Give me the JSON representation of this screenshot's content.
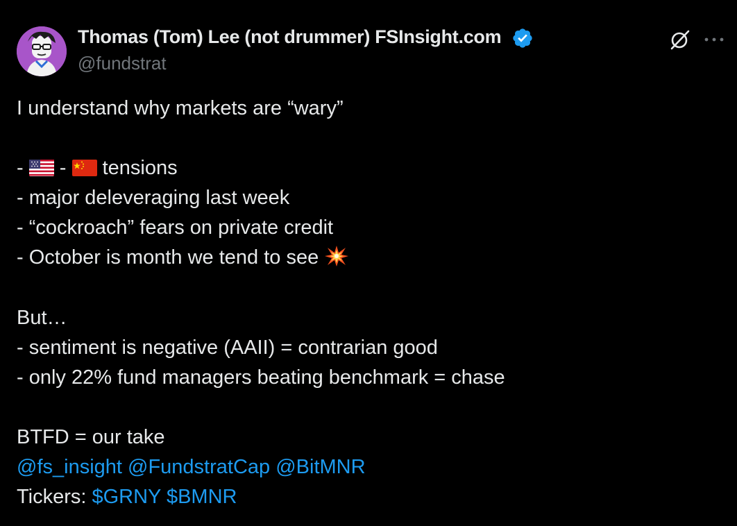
{
  "author": {
    "display_name": "Thomas (Tom) Lee (not drummer) FSInsight.com",
    "handle": "@fundstrat",
    "verified": true,
    "avatar_bg": "#a855c9"
  },
  "icons": {
    "verified": "verified-badge-icon",
    "grok": "grok-icon",
    "more": "more-icon",
    "us_flag": "us-flag-icon",
    "cn_flag": "china-flag-icon",
    "boom": "collision-icon"
  },
  "tweet": {
    "intro": "I understand why markets are “wary”",
    "tensions_prefix": "- ",
    "tensions_sep": " - ",
    "tensions_suffix": " tensions",
    "line_deleveraging": "- major deleveraging last week",
    "line_cockroach": "- “cockroach” fears on private credit",
    "line_october": "- October is month we tend to see ",
    "but": "But…",
    "line_sentiment": "- sentiment is negative (AAII) = contrarian good",
    "line_fund_managers": "- only 22% fund managers beating benchmark = chase",
    "btfd": "BTFD = our take",
    "mentions": [
      "@fs_insight",
      "@FundstratCap",
      "@BitMNR"
    ],
    "tickers_label": "Tickers: ",
    "cashtags": [
      "$GRNY",
      "$BMNR"
    ]
  },
  "colors": {
    "background": "#000000",
    "text": "#e7e9ea",
    "secondary": "#71767b",
    "link": "#1d9bf0"
  }
}
